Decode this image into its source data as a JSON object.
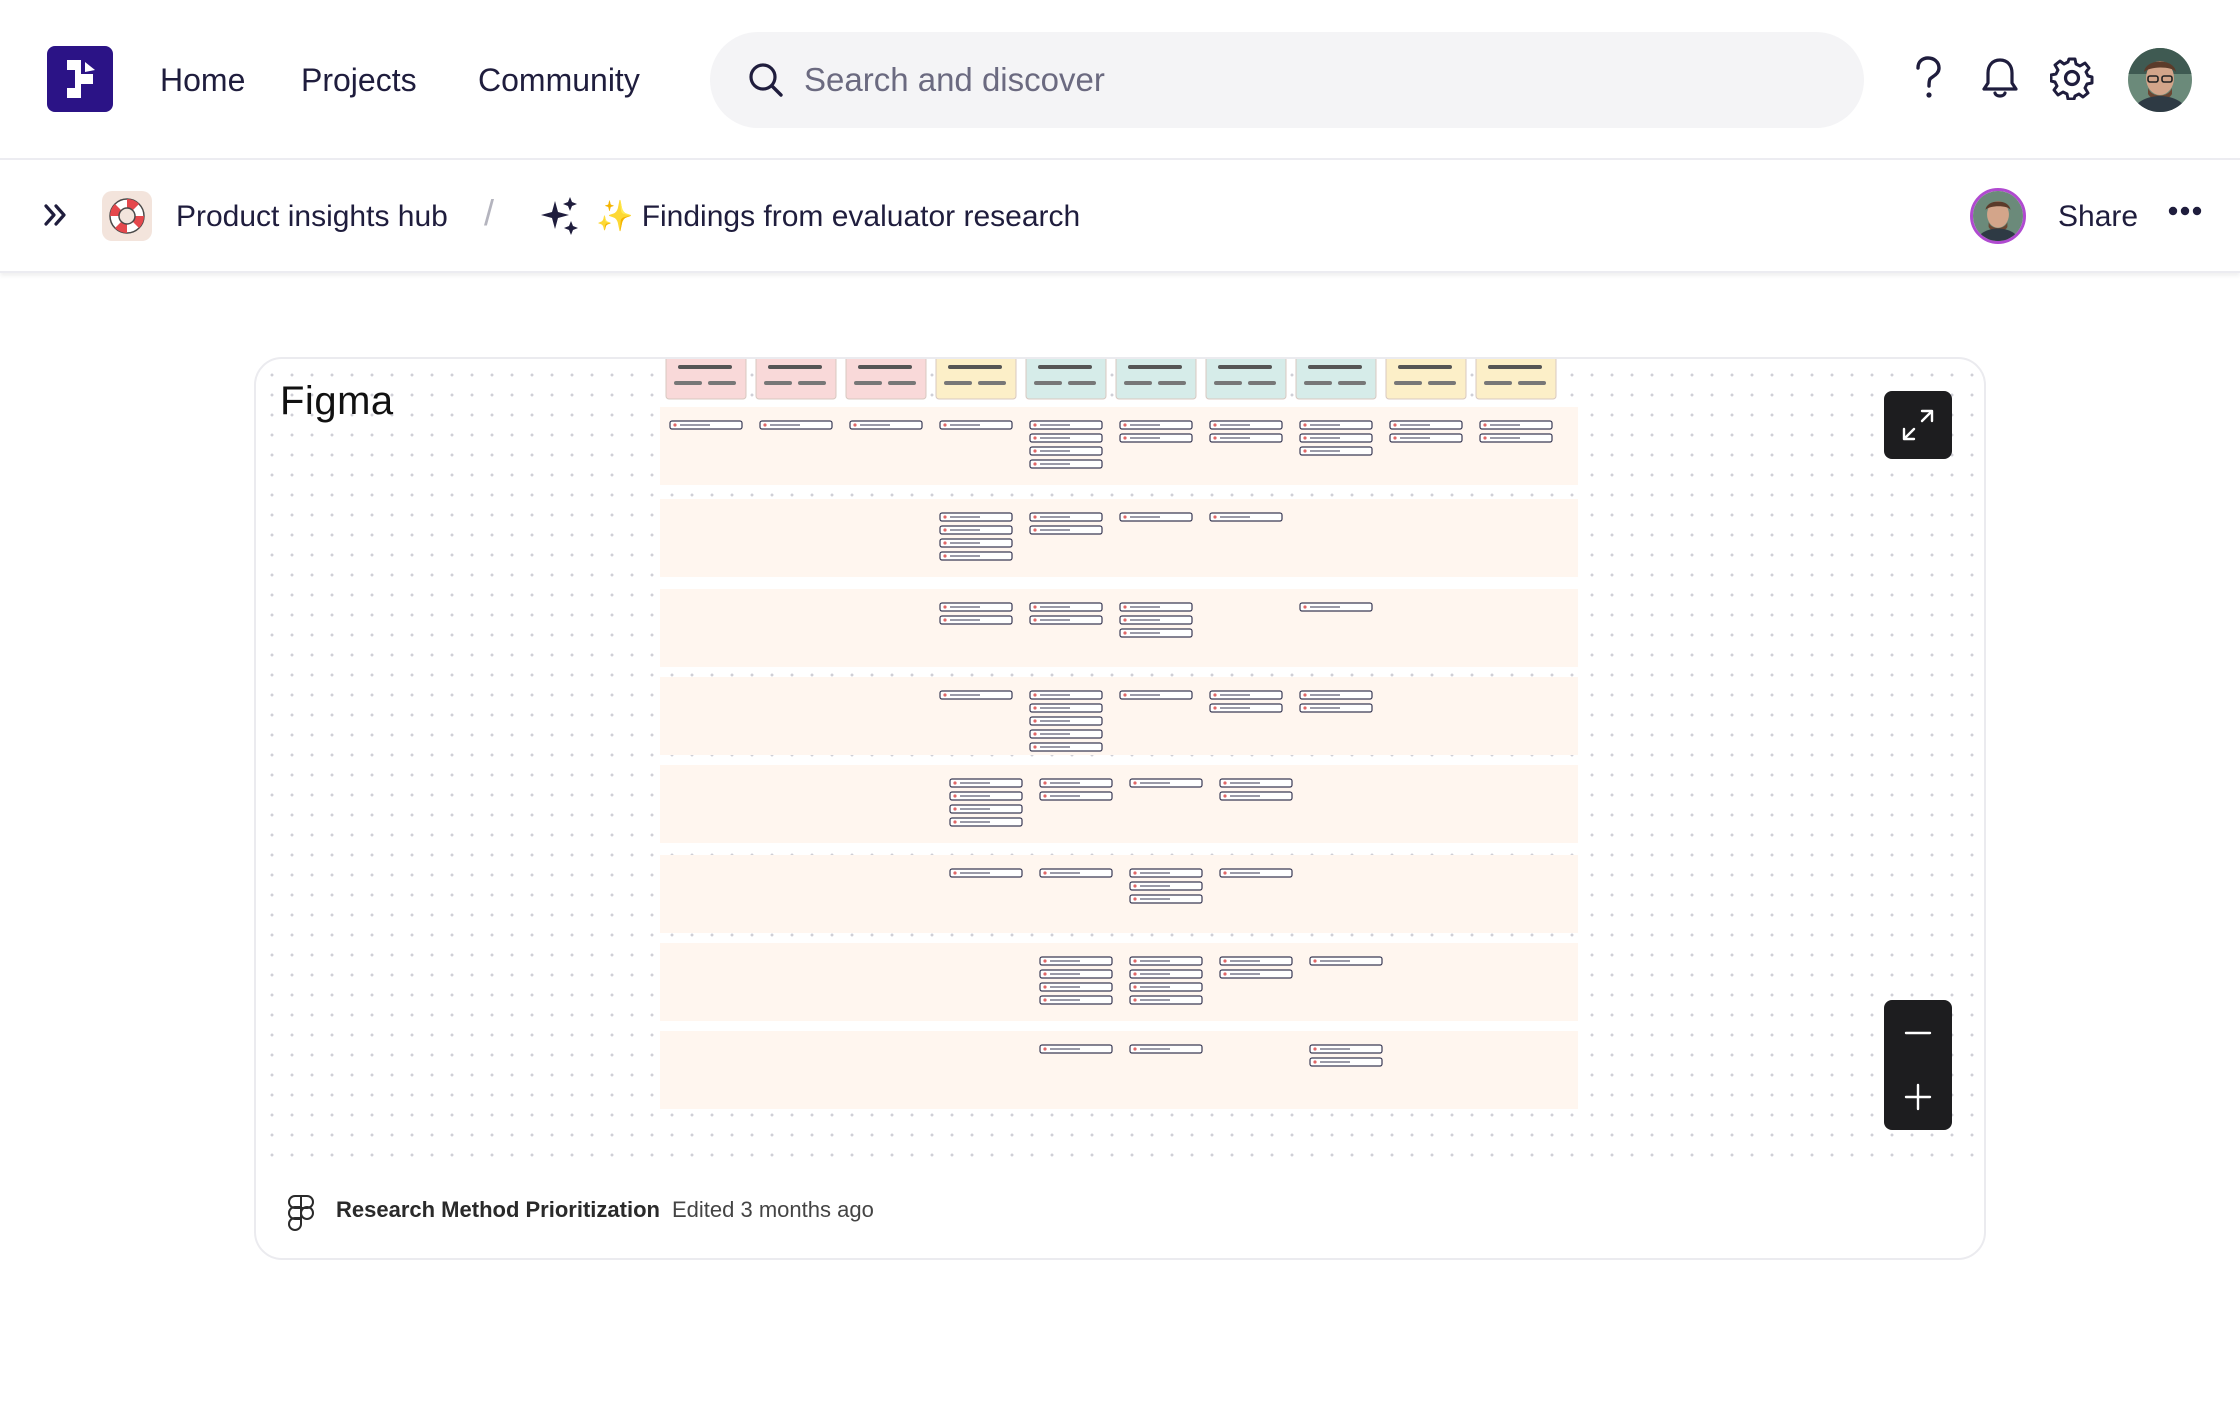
{
  "nav": {
    "items": [
      {
        "label": "Home"
      },
      {
        "label": "Projects"
      },
      {
        "label": "Community"
      }
    ],
    "search_placeholder": "Search and discover",
    "icons": [
      "search-icon",
      "help-icon",
      "bell-icon",
      "gear-icon"
    ]
  },
  "breadcrumb": {
    "hub": "Product insights hub",
    "separator": "/",
    "page": "✨ Findings from evaluator research",
    "share_label": "Share"
  },
  "embed": {
    "canvas_title": "Figma",
    "file_name": "Research Method Prioritization",
    "edited": "Edited 3 months ago"
  },
  "colors": {
    "brand": "#2b1386",
    "text": "#1f1d3d",
    "row_bg": "#fff6ef"
  }
}
